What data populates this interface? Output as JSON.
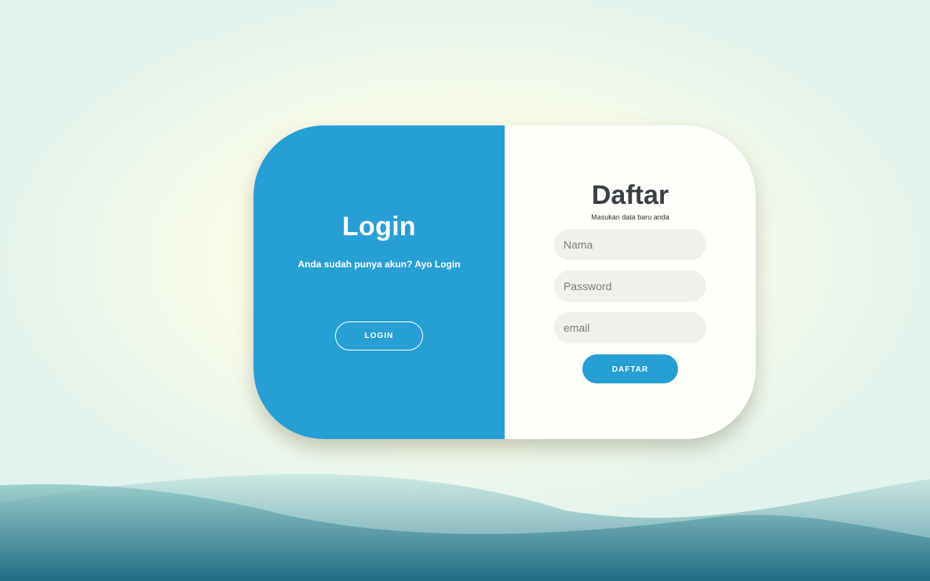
{
  "login_panel": {
    "title": "Login",
    "subtitle": "Anda sudah punya akun? Ayo Login",
    "button_label": "LOGIN"
  },
  "register_panel": {
    "title": "Daftar",
    "subtitle": "Masukan data baru anda",
    "fields": {
      "name": {
        "value": "",
        "placeholder": "Nama"
      },
      "password": {
        "value": "",
        "placeholder": "Password"
      },
      "email": {
        "value": "",
        "placeholder": "email"
      }
    },
    "button_label": "DAFTAR"
  },
  "colors": {
    "accent": "#279fd4",
    "heading": "#3a3f44",
    "input_background": "#f0f0ec",
    "wave_dark": "#1c6d80",
    "wave_light": "#a8d7d2"
  }
}
